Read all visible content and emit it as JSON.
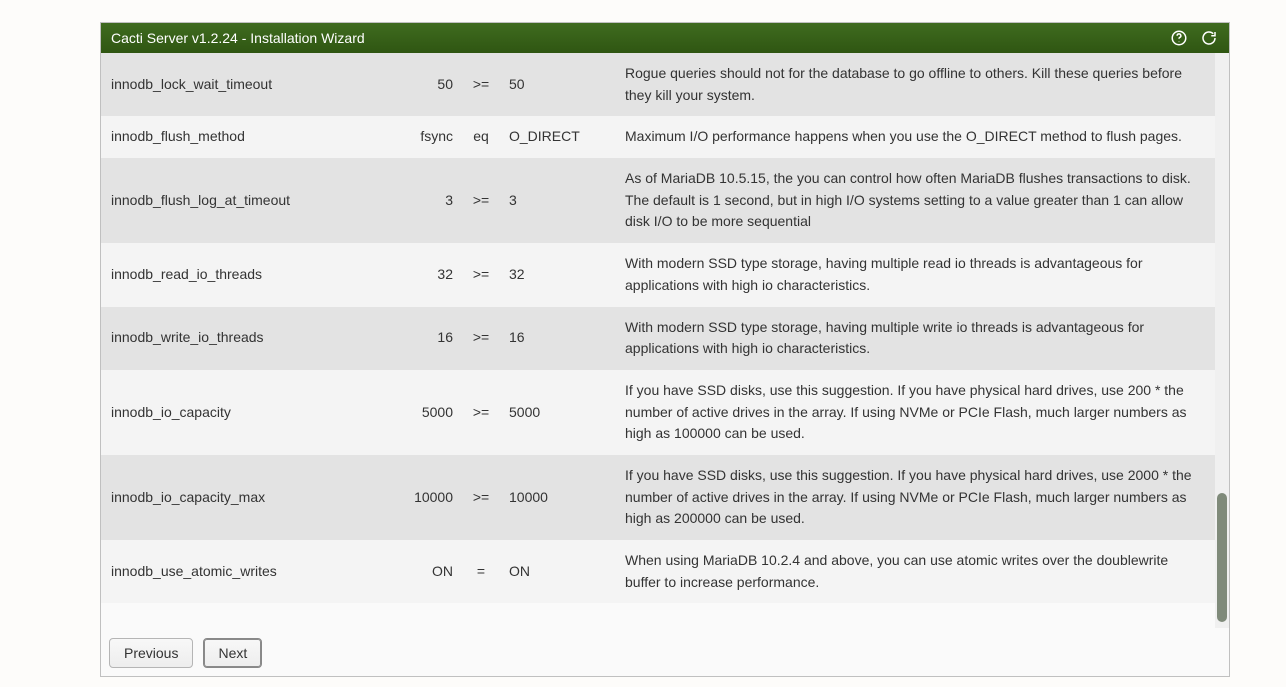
{
  "header": {
    "title": "Cacti Server v1.2.24 - Installation Wizard"
  },
  "footer": {
    "prev_label": "Previous",
    "next_label": "Next"
  },
  "rows": [
    {
      "name": "innodb_lock_wait_timeout",
      "current": "50",
      "op": ">=",
      "recommended": "50",
      "desc": "Rogue queries should not for the database to go offline to others. Kill these queries before they kill your system."
    },
    {
      "name": "innodb_flush_method",
      "current": "fsync",
      "op": "eq",
      "recommended": "O_DIRECT",
      "desc": "Maximum I/O performance happens when you use the O_DIRECT method to flush pages."
    },
    {
      "name": "innodb_flush_log_at_timeout",
      "current": "3",
      "op": ">=",
      "recommended": "3",
      "desc": "As of MariaDB 10.5.15, the you can control how often MariaDB flushes transactions to disk. The default is 1 second, but in high I/O systems setting to a value greater than 1 can allow disk I/O to be more sequential"
    },
    {
      "name": "innodb_read_io_threads",
      "current": "32",
      "op": ">=",
      "recommended": "32",
      "desc": "With modern SSD type storage, having multiple read io threads is advantageous for applications with high io characteristics."
    },
    {
      "name": "innodb_write_io_threads",
      "current": "16",
      "op": ">=",
      "recommended": "16",
      "desc": "With modern SSD type storage, having multiple write io threads is advantageous for applications with high io characteristics."
    },
    {
      "name": "innodb_io_capacity",
      "current": "5000",
      "op": ">=",
      "recommended": "5000",
      "desc": "If you have SSD disks, use this suggestion. If you have physical hard drives, use 200 * the number of active drives in the array. If using NVMe or PCIe Flash, much larger numbers as high as 100000 can be used."
    },
    {
      "name": "innodb_io_capacity_max",
      "current": "10000",
      "op": ">=",
      "recommended": "10000",
      "desc": "If you have SSD disks, use this suggestion. If you have physical hard drives, use 2000 * the number of active drives in the array. If using NVMe or PCIe Flash, much larger numbers as high as 200000 can be used."
    },
    {
      "name": "innodb_use_atomic_writes",
      "current": "ON",
      "op": "=",
      "recommended": "ON",
      "desc": "When using MariaDB 10.2.4 and above, you can use atomic writes over the doublewrite buffer to increase performance."
    }
  ]
}
